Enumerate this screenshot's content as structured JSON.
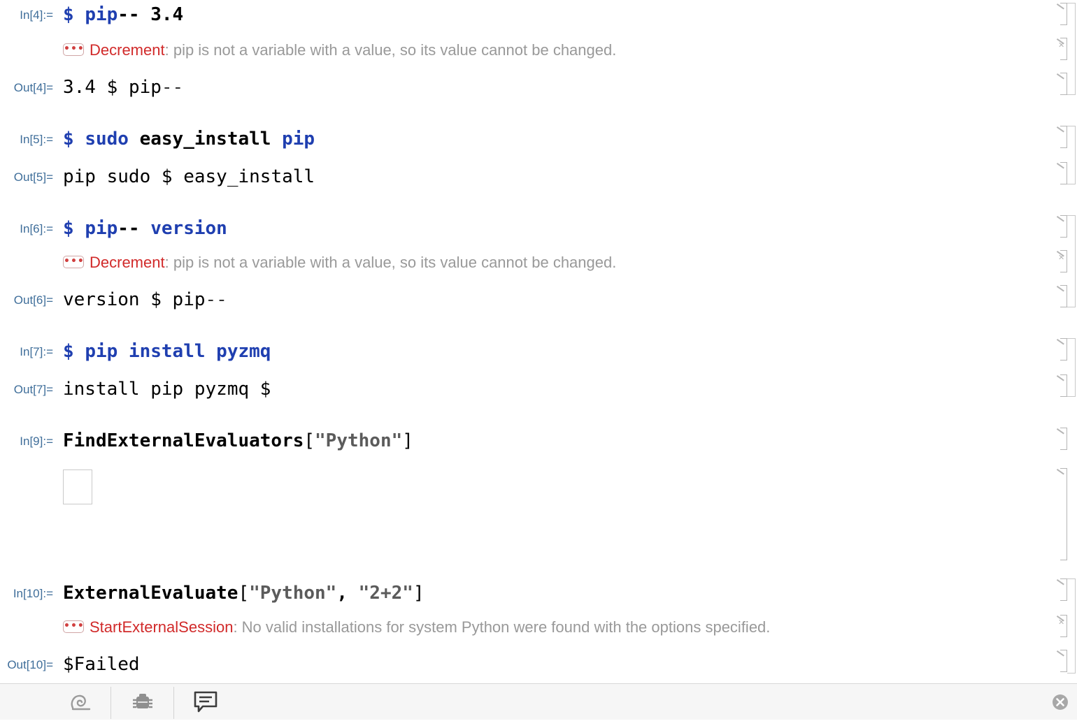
{
  "cells": {
    "c4": {
      "in_label": "In[4]:=",
      "in_code": [
        "$",
        "pip",
        "--",
        "3.4"
      ],
      "msg_tag": "Decrement",
      "msg_text": "pip is not a variable with a value, so its value cannot be changed.",
      "out_label": "Out[4]=",
      "out_code": [
        "3.4",
        "$",
        "pip",
        "--"
      ]
    },
    "c5": {
      "in_label": "In[5]:=",
      "in_code": [
        "$",
        "sudo",
        "easy_install",
        "pip"
      ],
      "out_label": "Out[5]=",
      "out_code": [
        "pip",
        "sudo",
        "$",
        "easy_install"
      ]
    },
    "c6": {
      "in_label": "In[6]:=",
      "in_code": [
        "$",
        "pip",
        "--",
        "version"
      ],
      "msg_tag": "Decrement",
      "msg_text": "pip is not a variable with a value, so its value cannot be changed.",
      "out_label": "Out[6]=",
      "out_code": [
        "version",
        "$",
        "pip",
        "--"
      ]
    },
    "c7": {
      "in_label": "In[7]:=",
      "in_code": [
        "$",
        "pip",
        "install",
        "pyzmq"
      ],
      "out_label": "Out[7]=",
      "out_code": [
        "install",
        "pip",
        "pyzmq",
        "$"
      ]
    },
    "c9": {
      "in_label": "In[9]:=",
      "in_func": "FindExternalEvaluators",
      "in_args": "[",
      "in_str": "\"Python\"",
      "in_close": "]"
    },
    "c10": {
      "in_label": "In[10]:=",
      "in_func": "ExternalEvaluate",
      "in_open": "[",
      "in_str1": "\"Python\"",
      "in_comma": ", ",
      "in_str2": "\"2+2\"",
      "in_close": "]",
      "msg_tag": "StartExternalSession",
      "msg_text": "No valid installations for system Python were found with the options specified.",
      "out_label": "Out[10]=",
      "out_value": "$Failed"
    }
  },
  "message_button_glyph": "•••",
  "toolbar": {
    "items": [
      "spiral-icon",
      "debugger-icon",
      "message-icon"
    ],
    "close": "close-circle-icon"
  },
  "colors": {
    "label": "#3f6e9a",
    "symbol": "#1f3fb0",
    "message_tag": "#d12a2a",
    "message_text": "#999999"
  }
}
